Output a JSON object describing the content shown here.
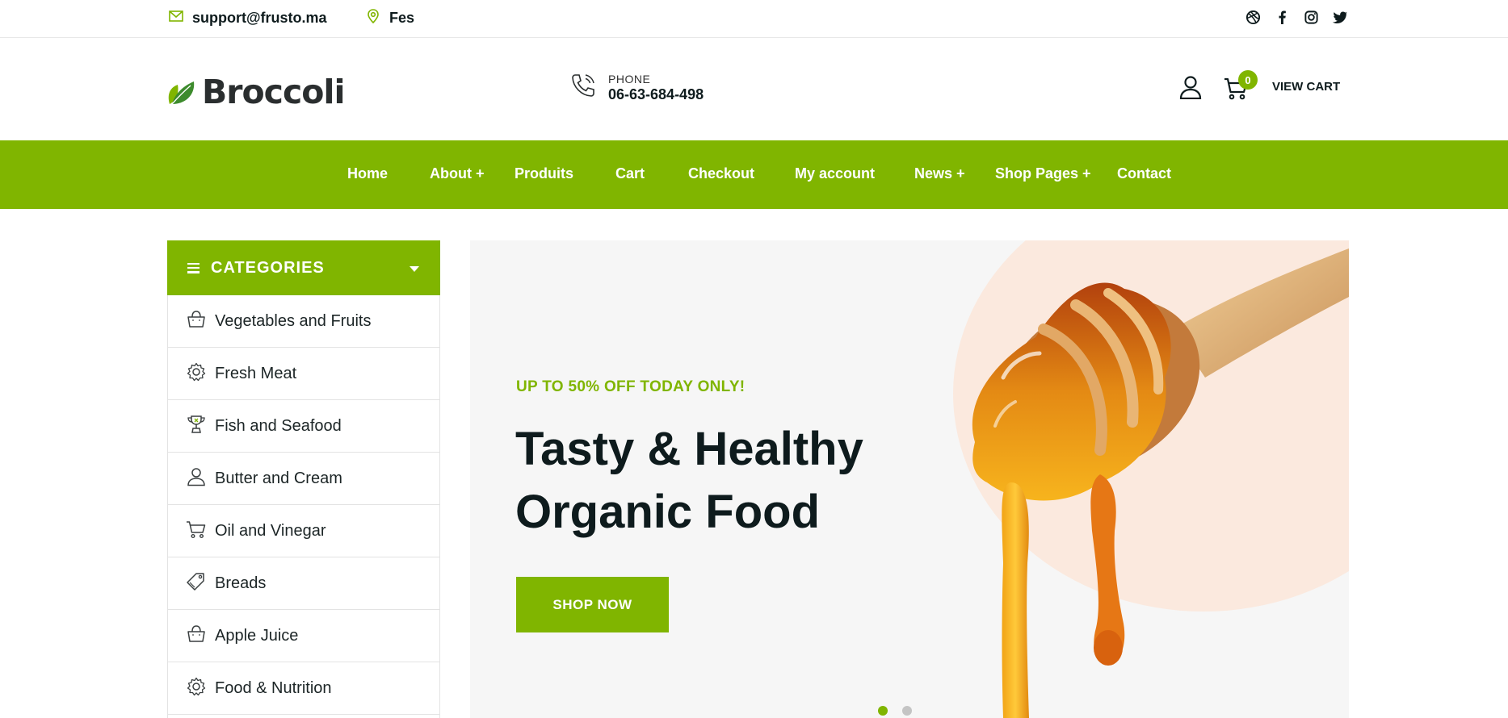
{
  "topbar": {
    "email": "support@frusto.ma",
    "location": "Fes",
    "social": [
      "dribbble-icon",
      "facebook-icon",
      "instagram-icon",
      "twitter-icon"
    ]
  },
  "header": {
    "logo_text": "Broccoli",
    "phone_label": "PHONE",
    "phone_number": "06-63-684-498",
    "cart_count": "0",
    "view_cart": "VIEW CART"
  },
  "nav": {
    "items": [
      "Home",
      "About +",
      "Produits",
      "Cart",
      "Checkout",
      "My account",
      "News +",
      "Shop Pages +",
      "Contact"
    ]
  },
  "categories": {
    "title": "CATEGORIES",
    "items": [
      {
        "label": "Vegetables and Fruits",
        "icon": "basket-icon"
      },
      {
        "label": "Fresh Meat",
        "icon": "gear-icon"
      },
      {
        "label": "Fish and Seafood",
        "icon": "trophy-icon"
      },
      {
        "label": "Butter and Cream",
        "icon": "user-icon"
      },
      {
        "label": "Oil and Vinegar",
        "icon": "cart-icon"
      },
      {
        "label": "Breads",
        "icon": "tag-icon"
      },
      {
        "label": "Apple Juice",
        "icon": "basket-icon"
      },
      {
        "label": "Food & Nutrition",
        "icon": "gear-icon"
      }
    ]
  },
  "banner": {
    "promo": "UP TO 50% OFF TODAY ONLY!",
    "headline": "Tasty & Healthy Organic Food",
    "button": "SHOP NOW",
    "slides": 2,
    "active_slide": 1
  },
  "colors": {
    "accent": "#80b500",
    "dark": "#0e1b1d",
    "banner_bg": "#f6f6f6",
    "blob": "#fbe9de"
  }
}
